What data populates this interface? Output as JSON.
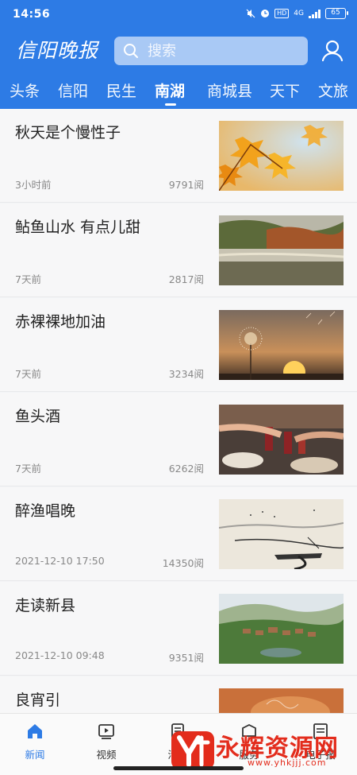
{
  "status_bar": {
    "time": "14:56",
    "network": "4G",
    "hd": "HD",
    "battery": "65"
  },
  "header": {
    "logo_text": "信阳晚报",
    "search_placeholder": "搜索"
  },
  "tabs": [
    {
      "label": "头条",
      "active": false
    },
    {
      "label": "信阳",
      "active": false
    },
    {
      "label": "民生",
      "active": false
    },
    {
      "label": "南湖",
      "active": true
    },
    {
      "label": "商城县",
      "active": false
    },
    {
      "label": "天下",
      "active": false
    },
    {
      "label": "文旅",
      "active": false
    }
  ],
  "articles": [
    {
      "title": "秋天是个慢性子",
      "time": "3小时前",
      "reads": "9791阅",
      "image": "autumn-maple-leaves"
    },
    {
      "title": "鲇鱼山水 有点儿甜",
      "time": "7天前",
      "reads": "2817阅",
      "image": "lake-landscape"
    },
    {
      "title": "赤裸裸地加油",
      "time": "7天前",
      "reads": "3234阅",
      "image": "dandelion-sunset"
    },
    {
      "title": "鱼头酒",
      "time": "7天前",
      "reads": "6262阅",
      "image": "toast-glasses"
    },
    {
      "title": "醉渔唱晚",
      "time": "2021-12-10 17:50",
      "reads": "14350阅",
      "image": "ink-fishing-painting"
    },
    {
      "title": "走读新县",
      "time": "2021-12-10 09:48",
      "reads": "9351阅",
      "image": "village-hills"
    },
    {
      "title": "良宵引",
      "time": "",
      "reads": "",
      "image": "warm-food"
    }
  ],
  "bottom_nav": [
    {
      "label": "新闻",
      "icon": "home-icon",
      "active": true
    },
    {
      "label": "视频",
      "icon": "video-icon",
      "active": false
    },
    {
      "label": "活动",
      "icon": "activity-icon",
      "active": false
    },
    {
      "label": "服务",
      "icon": "service-icon",
      "active": false
    },
    {
      "label": "电子报",
      "icon": "epaper-icon",
      "active": false
    }
  ],
  "watermark": {
    "text": "永辉资源网",
    "url": "www.yhkjjj.com"
  },
  "colors": {
    "brand_blue": "#2d7be5",
    "watermark_red": "#e32c1c"
  }
}
